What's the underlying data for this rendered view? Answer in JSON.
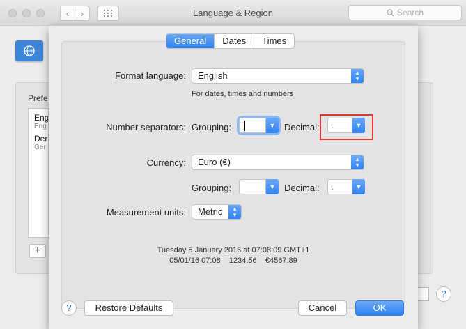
{
  "window": {
    "title": "Language & Region",
    "search_placeholder": "Search"
  },
  "background": {
    "list_label": "Prefe",
    "languages": [
      {
        "name": "Eng",
        "sub": "Eng"
      },
      {
        "name": "Der",
        "sub": "Ger"
      }
    ],
    "add_label": "+",
    "help_label": "?"
  },
  "sheet": {
    "tabs": [
      {
        "label": "General",
        "active": true
      },
      {
        "label": "Dates",
        "active": false
      },
      {
        "label": "Times",
        "active": false
      }
    ],
    "format_language": {
      "label": "Format language:",
      "value": "English",
      "hint": "For dates, times and numbers"
    },
    "number_separators": {
      "label": "Number separators:",
      "grouping_label": "Grouping:",
      "grouping_value": "",
      "decimal_label": "Decimal:",
      "decimal_value": "."
    },
    "currency": {
      "label": "Currency:",
      "value": "Euro (€)",
      "grouping_label": "Grouping:",
      "grouping_value": "",
      "decimal_label": "Decimal:",
      "decimal_value": "."
    },
    "measurement": {
      "label": "Measurement units:",
      "value": "Metric"
    },
    "sample": {
      "line1": "Tuesday 5 January 2016 at 07:08:09 GMT+1",
      "line2": "05/01/16 07:08    1234.56    €4567.89"
    },
    "buttons": {
      "help": "?",
      "restore": "Restore Defaults",
      "cancel": "Cancel",
      "ok": "OK"
    }
  },
  "icons": {
    "flag": "un-flag-icon",
    "search": "magnifier-icon",
    "chevron": "up-down-chevron-icon",
    "dropdown": "chevron-down-icon",
    "grid": "grid-icon"
  },
  "colors": {
    "accent": "#2f83f2",
    "highlight": "#e8352f"
  }
}
